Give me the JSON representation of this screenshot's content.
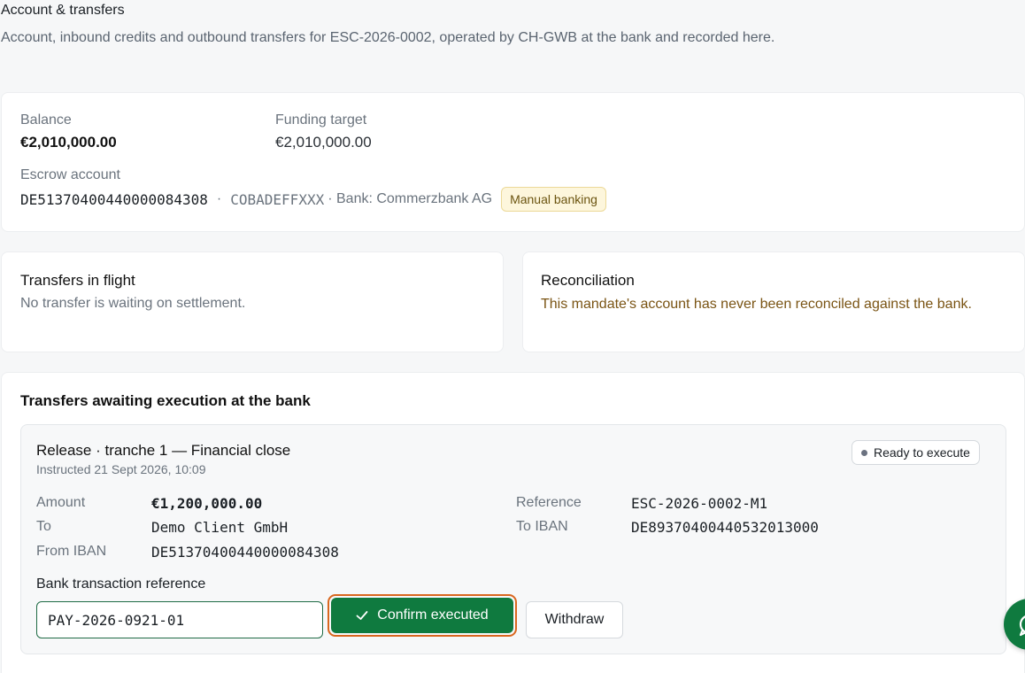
{
  "header": {
    "title": "Account & transfers",
    "subtitle": "Account, inbound credits and outbound transfers for ESC-2026-0002, operated by CH-GWB at the bank and recorded here."
  },
  "account": {
    "balance_label": "Balance",
    "balance_value": "€2,010,000.00",
    "funding_label": "Funding target",
    "funding_value": "€2,010,000.00",
    "escrow_label": "Escrow account",
    "iban": "DE51370400440000084308",
    "sep1": "·",
    "bic": "COBADEFFXXX",
    "bank_text": "· Bank: Commerzbank AG",
    "badge": "Manual banking"
  },
  "in_flight": {
    "title": "Transfers in flight",
    "message": "No transfer is waiting on settlement."
  },
  "reconciliation": {
    "title": "Reconciliation",
    "message": "This mandate's account has never been reconciled against the bank."
  },
  "awaiting": {
    "title": "Transfers awaiting execution at the bank",
    "transfer": {
      "title": "Release · tranche 1 — Financial close",
      "instructed": "Instructed 21 Sept 2026, 10:09",
      "status": "Ready to execute",
      "amount_label": "Amount",
      "amount_value": "€1,200,000.00",
      "to_label": "To",
      "to_value": "Demo Client GmbH",
      "from_iban_label": "From IBAN",
      "from_iban_value": "DE51370400440000084308",
      "reference_label": "Reference",
      "reference_value": "ESC-2026-0002-M1",
      "to_iban_label": "To IBAN",
      "to_iban_value": "DE89370400440532013000",
      "bank_ref_label": "Bank transaction reference",
      "bank_ref_value": "PAY-2026-0921-01",
      "confirm_label": "Confirm executed",
      "withdraw_label": "Withdraw"
    }
  },
  "colors": {
    "primary_green": "#0f7a3f",
    "focus_orange": "#d9671f",
    "warning_text": "#7a5414",
    "badge_bg": "#fdf6dc"
  }
}
